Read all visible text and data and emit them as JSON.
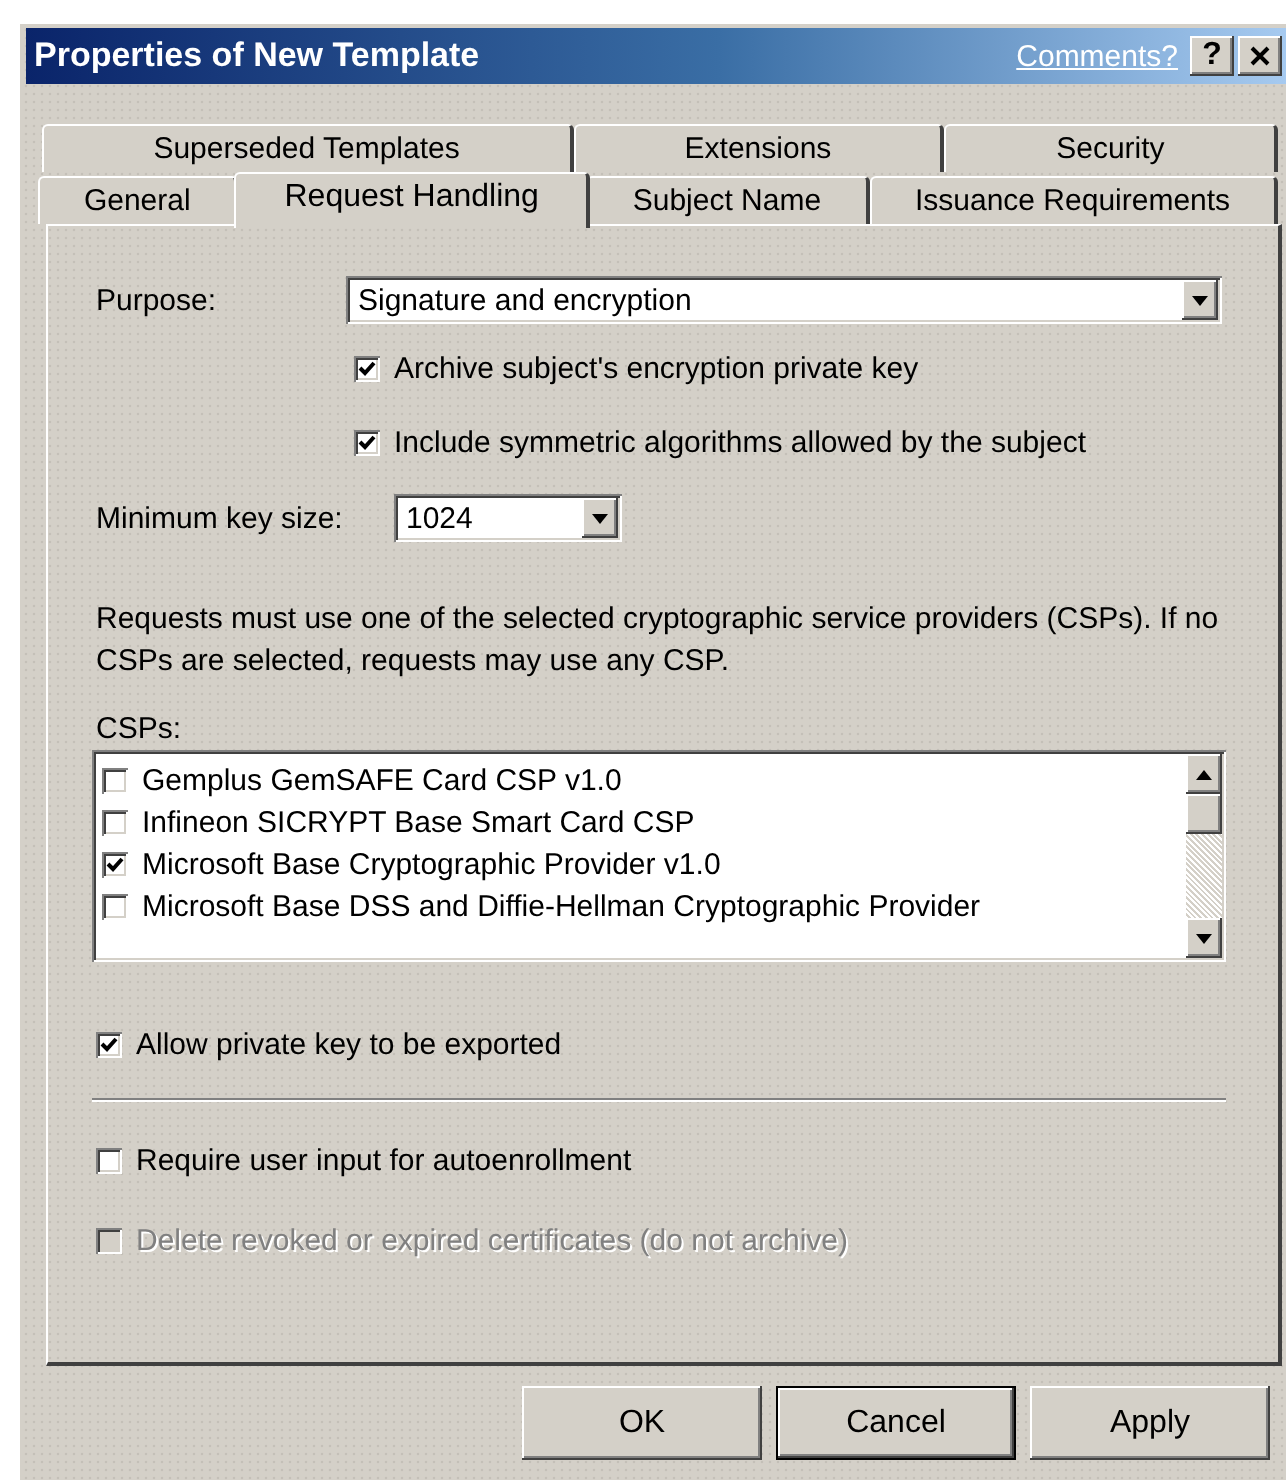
{
  "window": {
    "title": "Properties of New Template",
    "comments_link": "Comments?",
    "help_button": "?"
  },
  "tab_rows": [
    [
      {
        "label": "Superseded Templates",
        "selected": false
      },
      {
        "label": "Extensions",
        "selected": false
      },
      {
        "label": "Security",
        "selected": false
      }
    ],
    [
      {
        "label": "General",
        "selected": false
      },
      {
        "label": "Request Handling",
        "selected": true
      },
      {
        "label": "Subject Name",
        "selected": false
      },
      {
        "label": "Issuance Requirements",
        "selected": false
      }
    ]
  ],
  "purpose": {
    "label": "Purpose:",
    "value": "Signature and encryption"
  },
  "purpose_options": [
    {
      "label": "Archive subject's encryption private key",
      "checked": true
    },
    {
      "label": "Include symmetric algorithms allowed by the subject",
      "checked": true
    }
  ],
  "key_size": {
    "label": "Minimum key size:",
    "value": "1024"
  },
  "description": "Requests must use one of the selected cryptographic service providers (CSPs).  If no CSPs are selected, requests may use any CSP.",
  "csps": {
    "label": "CSPs:",
    "items": [
      {
        "label": "Gemplus GemSAFE Card CSP v1.0",
        "checked": false
      },
      {
        "label": "Infineon SICRYPT Base Smart Card CSP",
        "checked": false
      },
      {
        "label": "Microsoft Base Cryptographic Provider v1.0",
        "checked": true
      },
      {
        "label": "Microsoft Base DSS and Diffie-Hellman Cryptographic Provider",
        "checked": false
      }
    ]
  },
  "export_options": [
    {
      "label": "Allow private key to be exported",
      "checked": true,
      "disabled": false
    }
  ],
  "enrollment_options": [
    {
      "label": "Require user input for autoenrollment",
      "checked": false,
      "disabled": false
    },
    {
      "label": "Delete revoked or expired certificates (do not archive)",
      "checked": false,
      "disabled": true
    }
  ],
  "buttons": [
    {
      "label": "OK",
      "focused": false
    },
    {
      "label": "Cancel",
      "focused": true
    },
    {
      "label": "Apply",
      "focused": false
    }
  ]
}
